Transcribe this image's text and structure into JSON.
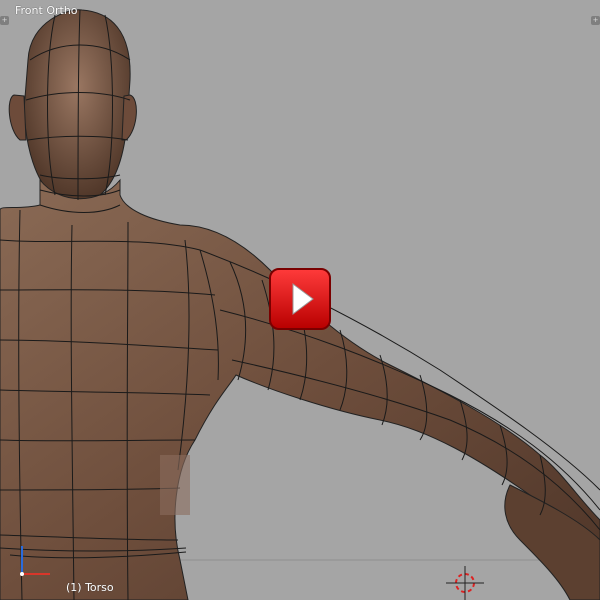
{
  "viewport": {
    "view_label": "Front Ortho",
    "object_label": "(1) Torso",
    "background": "#a5a5a5",
    "mesh_color": "#7a5a45"
  },
  "overlay": {
    "play_button_color": "#e00000",
    "play_icon": "play-icon"
  },
  "icons": [
    "view-expand-icon",
    "axis-gizmo-icon",
    "3d-cursor-icon",
    "play-icon"
  ]
}
